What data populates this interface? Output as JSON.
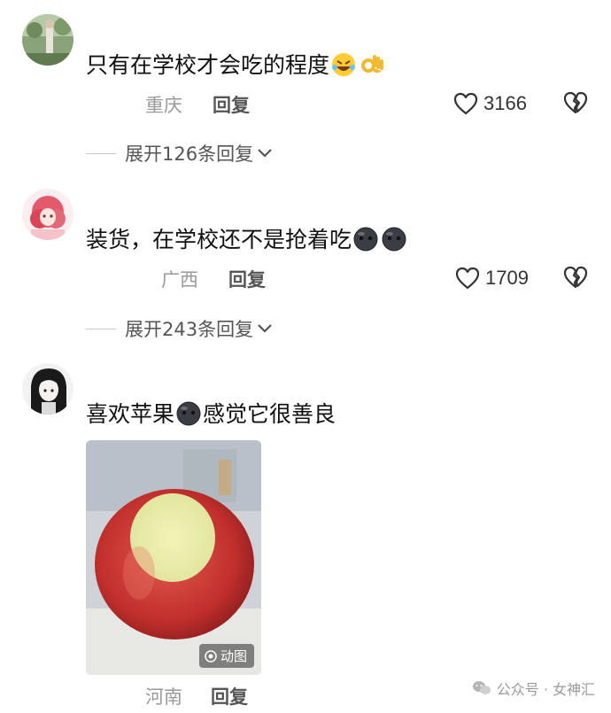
{
  "comments": [
    {
      "text": "只有在学校才会吃的程度",
      "emojis": [
        "rofl-emoji",
        "ok-hand-emoji"
      ],
      "location": "重庆",
      "reply_label": "回复",
      "likes": "3166",
      "expand_label": "展开126条回复"
    },
    {
      "text": "装货，在学校还不是抢着吃",
      "emojis": [
        "dark-face-emoji",
        "dark-face-emoji"
      ],
      "location": "广西",
      "reply_label": "回复",
      "likes": "1709",
      "expand_label": "展开243条回复"
    },
    {
      "text_before": "喜欢苹果",
      "text_after": "感觉它很善良",
      "emojis": [
        "dark-face-emoji"
      ],
      "location": "河南",
      "reply_label": "回复",
      "gif_label": "动图"
    }
  ],
  "watermark": {
    "text": "公众号 · 女神汇"
  },
  "colors": {
    "meta": "#9a9a9a",
    "reply": "#555555",
    "text": "#111111"
  }
}
